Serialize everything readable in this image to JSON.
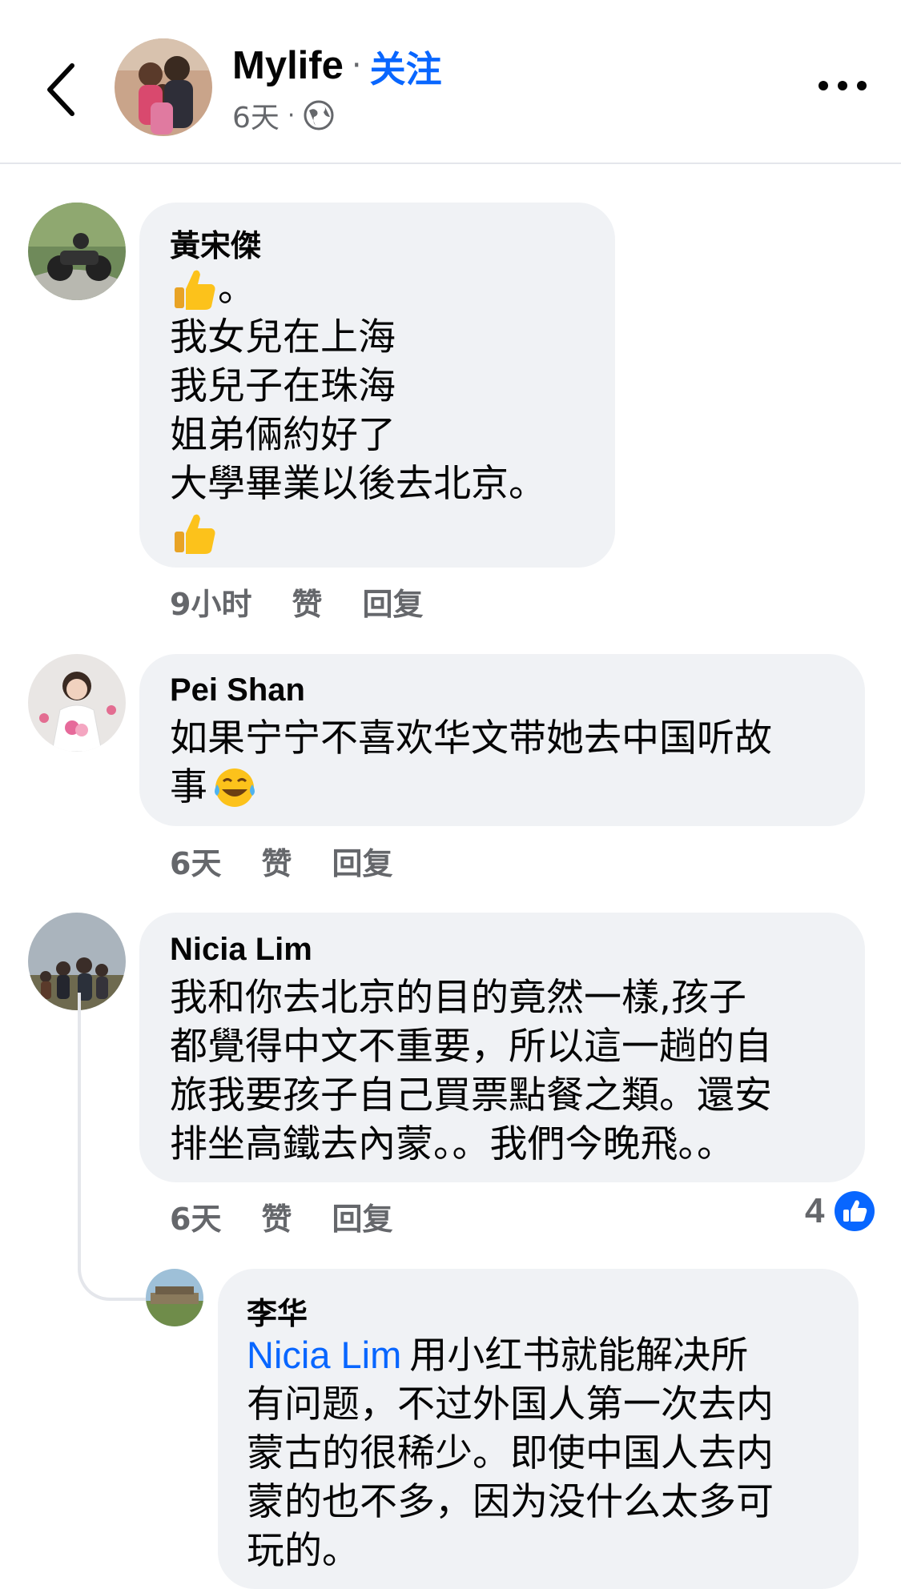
{
  "header": {
    "page_name": "Mylife",
    "separator": "·",
    "follow_label": "关注",
    "time": "6天",
    "time_separator": "·"
  },
  "comments": [
    {
      "author": "黃宋傑",
      "lines": [
        "。",
        "我女兒在上海",
        "我兒子在珠海",
        "姐弟倆約好了",
        "大學畢業以後去北京。"
      ],
      "time": "9小时",
      "like_label": "赞",
      "reply_label": "回复"
    },
    {
      "author": "Pei Shan",
      "lines": [
        "如果宁宁不喜欢华文带她去中国听故",
        "事"
      ],
      "time": "6天",
      "like_label": "赞",
      "reply_label": "回复"
    },
    {
      "author": "Nicia Lim",
      "lines": [
        "我和你去北京的目的竟然一樣,孩子",
        "都覺得中文不重要，所以這一趟的自",
        "旅我要孩子自己買票點餐之類。還安",
        "排坐高鐵去內蒙。。我們今晚飛。。"
      ],
      "time": "6天",
      "like_label": "赞",
      "reply_label": "回复",
      "reaction_count": "4"
    }
  ],
  "reply": {
    "author": "李华",
    "mention": "Nicia Lim",
    "first_line": "用小红书就能解决所",
    "lines": [
      "有问题，不过外国人第一次去内",
      "蒙古的很稀少。即使中国人去内",
      "蒙的也不多，因为没什么太多可",
      "玩的。"
    ]
  },
  "colors": {
    "accent": "#0866ff",
    "bubble": "#f0f2f5",
    "meta_text": "#65676b"
  },
  "icons": [
    "back-arrow-icon",
    "globe-icon",
    "more-options-icon",
    "thumbs-up-emoji-icon",
    "laughing-tears-emoji-icon",
    "like-reaction-icon"
  ]
}
